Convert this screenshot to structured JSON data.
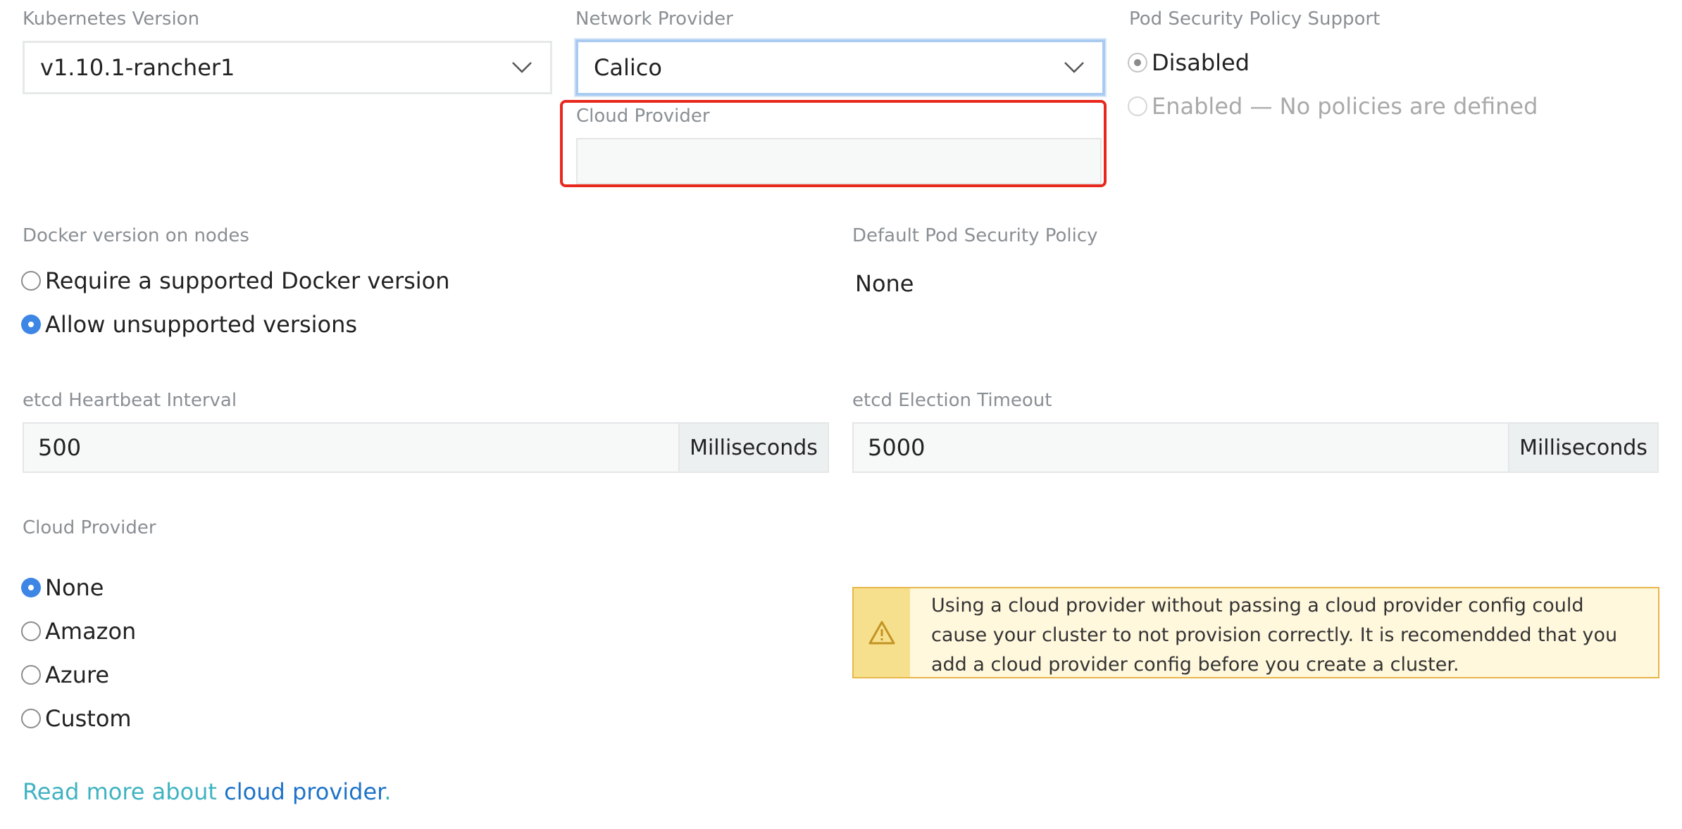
{
  "kubernetes": {
    "label": "Kubernetes Version",
    "value": "v1.10.1-rancher1"
  },
  "network": {
    "label": "Network Provider",
    "value": "Calico"
  },
  "cloud_provider_field": {
    "label": "Cloud Provider",
    "value": ""
  },
  "psp_support": {
    "label": "Pod Security Policy Support",
    "options": [
      "Disabled",
      "Enabled — No policies are defined"
    ],
    "selected": "Disabled"
  },
  "docker": {
    "label": "Docker version on nodes",
    "options": [
      "Require a supported Docker version",
      "Allow unsupported versions"
    ],
    "selected": "Allow unsupported versions"
  },
  "default_psp": {
    "label": "Default Pod Security Policy",
    "value": "None"
  },
  "etcd_heartbeat": {
    "label": "etcd Heartbeat Interval",
    "value": "500",
    "unit": "Milliseconds"
  },
  "etcd_election": {
    "label": "etcd Election Timeout",
    "value": "5000",
    "unit": "Milliseconds"
  },
  "cloud_provider": {
    "label": "Cloud Provider",
    "options": [
      "None",
      "Amazon",
      "Azure",
      "Custom"
    ],
    "selected": "None"
  },
  "warning": {
    "message": "Using a cloud provider without passing a cloud provider config could cause your cluster to not provision correctly. It is recomendded that you add a cloud provider config before you create a cluster."
  },
  "read_more": {
    "prefix": "Read more about",
    "link": "cloud provider",
    "suffix": "."
  },
  "icons": {
    "dropdown": "chevron-down-icon",
    "warning": "warning-triangle-icon"
  },
  "colors": {
    "accent_blue": "#3d86e6",
    "highlight_red": "#e8281c",
    "warning_bg": "#fff8dd",
    "warning_border": "#e8b64a",
    "link_teal": "#3fb3c1",
    "link_blue": "#1e73c8"
  }
}
